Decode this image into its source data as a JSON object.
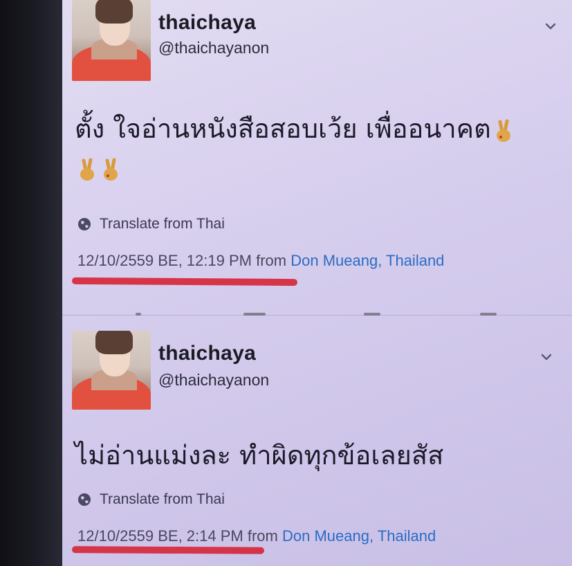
{
  "tweets": [
    {
      "display_name": "thaichaya",
      "handle": "@thaichayanon",
      "text": "ตั้ง ใจอ่านหนังสือสอบเว้ย เพื่ออนาคต",
      "emojis": [
        "victory-hand",
        "victory-hand",
        "victory-hand"
      ],
      "translate_label": "Translate from Thai",
      "timestamp": "12/10/2559 BE, 12:19 PM",
      "from_label": "from",
      "location": "Don Mueang, Thailand"
    },
    {
      "display_name": "thaichaya",
      "handle": "@thaichayanon",
      "text": "ไม่อ่านแม่งละ ทำผิดทุกข้อเลยสัส",
      "translate_label": "Translate from Thai",
      "timestamp": "12/10/2559 BE, 2:14 PM",
      "from_label": "from",
      "location": "Don Mueang, Thailand"
    }
  ],
  "colors": {
    "screen_bg": "#d8d0ee",
    "link": "#2b6cc4",
    "underline_marker": "#d6283a"
  },
  "icons": {
    "more": "chevron-down-icon",
    "translate": "globe-icon",
    "emoji": "victory-hand-emoji"
  }
}
